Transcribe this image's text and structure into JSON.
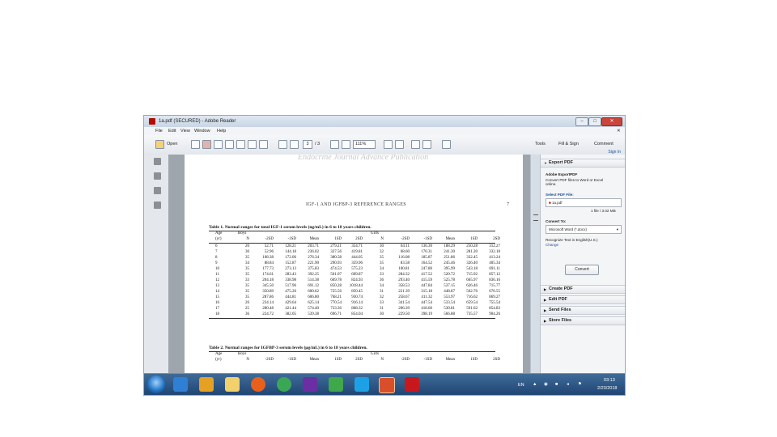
{
  "window": {
    "title": "1a.pdf (SECURED) - Adobe Reader",
    "controls": {
      "minimize": "–",
      "maximize": "□",
      "close": "✕"
    }
  },
  "menubar": {
    "items": [
      "File",
      "Edit",
      "View",
      "Window",
      "Help"
    ],
    "close_doc": "✕"
  },
  "toolbar": {
    "open_label": "Open",
    "page_current": "3",
    "page_total": "/ 3",
    "zoom": "111%",
    "tools_label": "Tools",
    "fill_sign_label": "Fill & Sign",
    "comment_label": "Comment"
  },
  "document": {
    "watermark": "Endocrine Journal Advance Publication",
    "running_title": "IGF-1 AND IGFBP-3 REFERENCE RANGES",
    "page_number": "7",
    "table1": {
      "caption": "Table 1. Normal ranges for total IGF-1 serum levels (ng/mL) in 6 to 18 years children.",
      "group_boys": "Boys",
      "group_girls": "Girls",
      "header": [
        "Age",
        "N",
        "-2SD",
        "-1SD",
        "Mean",
        "1SD",
        "2SD",
        "N",
        "-2SD",
        "-1SD",
        "Mean",
        "1SD",
        "2SD"
      ],
      "header2": "(yr)",
      "rows": [
        [
          "6",
          "20",
          "52.71",
          "128.21",
          "203.71",
          "279.21",
          "354.71",
          "30",
          "64.11",
          "136.30",
          "188.29",
          "250.28",
          "312.27"
        ],
        [
          "7",
          "30",
          "52.96",
          "144.18",
          "236.02",
          "327.56",
          "419.81",
          "32",
          "68.60",
          "170.31",
          "241.30",
          "281.20",
          "332.18"
        ],
        [
          "8",
          "35",
          "108.38",
          "172.06",
          "276.34",
          "380.58",
          "444.05",
          "35",
          "116.08",
          "185.87",
          "251.86",
          "332.45",
          "413.24"
        ],
        [
          "9",
          "34",
          "88.84",
          "152.87",
          "221.90",
          "290.93",
          "359.96",
          "35",
          "83.58",
          "164.52",
          "245.46",
          "326.40",
          "405.34"
        ],
        [
          "10",
          "35",
          "177.73",
          "273.13",
          "375.83",
          "474.53",
          "575.23",
          "34",
          "100.81",
          "247.80",
          "395.99",
          "543.18",
          "691.11"
        ],
        [
          "11",
          "35",
          "174.61",
          "283.43",
          "392.25",
          "501.07",
          "609.87",
          "33",
          "284.32",
          "417.52",
          "520.72",
          "715.92",
          "857.12"
        ],
        [
          "12",
          "33",
          "204.18",
          "338.98",
          "514.38",
          "669.78",
          "824.93",
          "36",
          "293.40",
          "415.59",
          "525.78",
          "665.97",
          "836.16"
        ],
        [
          "13",
          "35",
          "345.50",
          "517.96",
          "691.12",
          "850.28",
          "1018.44",
          "34",
          "358.53",
          "447.84",
          "537.15",
          "626.46",
          "715.77"
        ],
        [
          "14",
          "35",
          "350.89",
          "475.26",
          "600.62",
          "725.56",
          "850.45",
          "31",
          "221.39",
          "315.18",
          "448.87",
          "562.76",
          "676.55"
        ],
        [
          "15",
          "35",
          "287.86",
          "444.81",
          "606.80",
          "768.21",
          "930.74",
          "32",
          "258.67",
          "411.32",
          "553.97",
          "716.62",
          "869.27"
        ],
        [
          "16",
          "26",
          "234.14",
          "429.64",
          "625.14",
          "770.54",
          "916.14",
          "33",
          "341.54",
          "447.54",
          "533.54",
          "659.54",
          "755.54"
        ],
        [
          "17",
          "25",
          "280.48",
          "421.44",
          "574.40",
          "733.36",
          "868.32",
          "31",
          "206.39",
          "418.60",
          "530.81",
          "591.62",
          "854.83"
        ],
        [
          "18",
          "36",
          "224.72",
          "382.05",
          "539.38",
          "696.71",
          "854.04",
          "30",
          "229.50",
          "398.19",
          "566.88",
          "735.57",
          "904.26"
        ]
      ]
    },
    "table2": {
      "caption": "Table 2. Normal ranges for IGFBP-3 serum levels (μg/mL) in 6 to 18 years children.",
      "group_boys": "Boys",
      "group_girls": "Girls",
      "header": [
        "Age",
        "N",
        "-2SD",
        "-1SD",
        "Mean",
        "1SD",
        "2SD",
        "N",
        "-2SD",
        "-1SD",
        "Mean",
        "1SD",
        "2SD"
      ],
      "header2": "(yr)"
    }
  },
  "right_panel": {
    "sign_in": "Sign In",
    "export_pdf": "Export PDF",
    "export_desc_title": "Adobe ExportPDF",
    "export_desc": "Convert PDF files to Word or Excel online.",
    "select_label": "Select PDF File:",
    "selected_file": "1a.pdf",
    "file_count": "1 file / 3.02 MB",
    "convert_to_label": "Convert To:",
    "convert_to_value": "Microsoft Word (*.docx)",
    "recognize": "Recognize Text in English(U.S.)",
    "change_link": "Change",
    "convert_button": "Convert",
    "sections": [
      "Create PDF",
      "Edit PDF",
      "Send Files",
      "Store Files"
    ]
  },
  "taskbar": {
    "lang": "EN",
    "time": "03:13",
    "date": "2/23/2018"
  },
  "colors": {
    "adobe_red": "#b30b00",
    "taskbar": "#2b5282",
    "link_blue": "#1a4f9c"
  }
}
